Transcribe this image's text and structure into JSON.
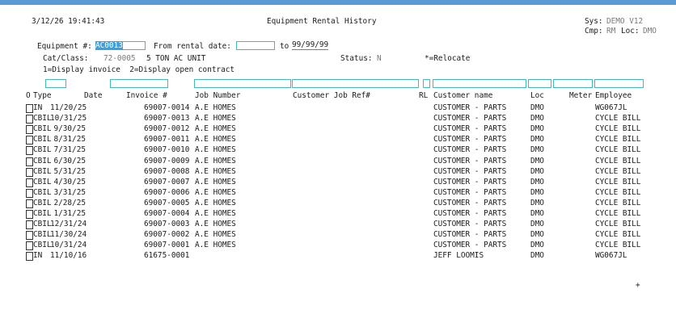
{
  "header": {
    "datetime": "3/12/26 19:41:43",
    "title": "Equipment Rental History",
    "sys_label": "Sys:",
    "sys_value": "DEMO V12",
    "cmp_label": "Cmp:",
    "cmp_value": "RM",
    "loc_label": "Loc:",
    "loc_value": "DMO"
  },
  "form": {
    "equipment_label": "Equipment #:",
    "equipment_value": "AC0013",
    "from_date_label": "From rental date:",
    "from_date_value": "",
    "to_label": "to",
    "to_date_value": "99/99/99",
    "catclass_label": "Cat/Class:",
    "catclass_value": "72-0005",
    "catclass_desc": "5 TON AC UNIT",
    "status_label": "Status:",
    "status_value": "N",
    "relocate_note": "*=Relocate",
    "options_text": "1=Display invoice  2=Display open contract"
  },
  "columns": {
    "o": "O",
    "type": "Type",
    "date": "Date",
    "invoice": "Invoice #",
    "job_number": "Job Number",
    "customer_job_ref": "Customer Job Ref#",
    "rl": "RL",
    "customer_name": "Customer name",
    "loc": "Loc",
    "meter": "Meter",
    "employee": "Employee"
  },
  "rows": [
    {
      "type": "IN",
      "date": "11/20/25",
      "invoice": "69007-0014",
      "job": "A.E HOMES",
      "customer": "CUSTOMER - PARTS",
      "loc": "DMO",
      "employee": "WG067JL"
    },
    {
      "type": "CBIL",
      "date": "10/31/25",
      "invoice": "69007-0013",
      "job": "A.E HOMES",
      "customer": "CUSTOMER - PARTS",
      "loc": "DMO",
      "employee": "CYCLE BILL"
    },
    {
      "type": "CBIL",
      "date": "9/30/25",
      "invoice": "69007-0012",
      "job": "A.E HOMES",
      "customer": "CUSTOMER - PARTS",
      "loc": "DMO",
      "employee": "CYCLE BILL"
    },
    {
      "type": "CBIL",
      "date": "8/31/25",
      "invoice": "69007-0011",
      "job": "A.E HOMES",
      "customer": "CUSTOMER - PARTS",
      "loc": "DMO",
      "employee": "CYCLE BILL"
    },
    {
      "type": "CBIL",
      "date": "7/31/25",
      "invoice": "69007-0010",
      "job": "A.E HOMES",
      "customer": "CUSTOMER - PARTS",
      "loc": "DMO",
      "employee": "CYCLE BILL"
    },
    {
      "type": "CBIL",
      "date": "6/30/25",
      "invoice": "69007-0009",
      "job": "A.E HOMES",
      "customer": "CUSTOMER - PARTS",
      "loc": "DMO",
      "employee": "CYCLE BILL"
    },
    {
      "type": "CBIL",
      "date": "5/31/25",
      "invoice": "69007-0008",
      "job": "A.E HOMES",
      "customer": "CUSTOMER - PARTS",
      "loc": "DMO",
      "employee": "CYCLE BILL"
    },
    {
      "type": "CBIL",
      "date": "4/30/25",
      "invoice": "69007-0007",
      "job": "A.E HOMES",
      "customer": "CUSTOMER - PARTS",
      "loc": "DMO",
      "employee": "CYCLE BILL"
    },
    {
      "type": "CBIL",
      "date": "3/31/25",
      "invoice": "69007-0006",
      "job": "A.E HOMES",
      "customer": "CUSTOMER - PARTS",
      "loc": "DMO",
      "employee": "CYCLE BILL"
    },
    {
      "type": "CBIL",
      "date": "2/28/25",
      "invoice": "69007-0005",
      "job": "A.E HOMES",
      "customer": "CUSTOMER - PARTS",
      "loc": "DMO",
      "employee": "CYCLE BILL"
    },
    {
      "type": "CBIL",
      "date": "1/31/25",
      "invoice": "69007-0004",
      "job": "A.E HOMES",
      "customer": "CUSTOMER - PARTS",
      "loc": "DMO",
      "employee": "CYCLE BILL"
    },
    {
      "type": "CBIL",
      "date": "12/31/24",
      "invoice": "69007-0003",
      "job": "A.E HOMES",
      "customer": "CUSTOMER - PARTS",
      "loc": "DMO",
      "employee": "CYCLE BILL"
    },
    {
      "type": "CBIL",
      "date": "11/30/24",
      "invoice": "69007-0002",
      "job": "A.E HOMES",
      "customer": "CUSTOMER - PARTS",
      "loc": "DMO",
      "employee": "CYCLE BILL"
    },
    {
      "type": "CBIL",
      "date": "10/31/24",
      "invoice": "69007-0001",
      "job": "A.E HOMES",
      "customer": "CUSTOMER - PARTS",
      "loc": "DMO",
      "employee": "CYCLE BILL"
    },
    {
      "type": "IN",
      "date": "11/10/16",
      "invoice": "61675-0001",
      "job": "",
      "customer": "JEFF LOOMIS",
      "loc": "DMO",
      "employee": "WG067JL"
    }
  ],
  "more_indicator": "+"
}
